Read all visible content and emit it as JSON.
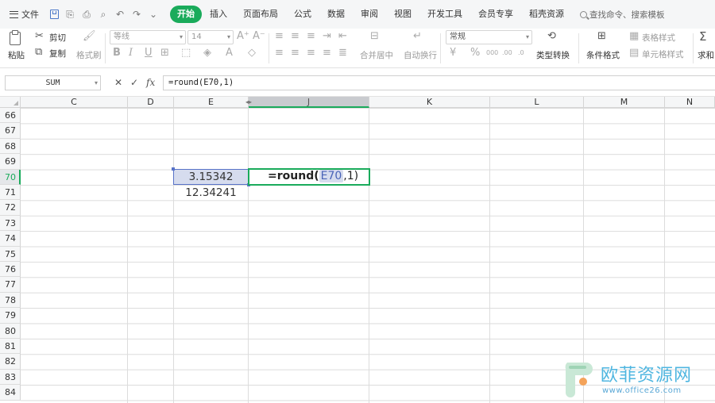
{
  "menubar": {
    "file_label": "文件",
    "tabs": [
      {
        "label": "开始",
        "active": true
      },
      {
        "label": "插入"
      },
      {
        "label": "页面布局"
      },
      {
        "label": "公式"
      },
      {
        "label": "数据"
      },
      {
        "label": "审阅"
      },
      {
        "label": "视图"
      },
      {
        "label": "开发工具"
      },
      {
        "label": "会员专享"
      },
      {
        "label": "稻壳资源"
      }
    ],
    "search_placeholder": "查找命令、搜索模板"
  },
  "ribbon": {
    "paste": "粘贴",
    "cut": "剪切",
    "copy": "复制",
    "format_painter": "格式刷",
    "font_name": "等线",
    "font_size": "14",
    "merge_center": "合并居中",
    "wrap_text": "自动换行",
    "number_format": "常规",
    "type_convert": "类型转换",
    "conditional_format": "条件格式",
    "table_style": "表格样式",
    "cell_style": "单元格样式",
    "sum": "求和"
  },
  "formula_bar": {
    "name_box": "SUM",
    "formula": "=round(E70,1)"
  },
  "sheet": {
    "columns": [
      {
        "label": "C"
      },
      {
        "label": "D"
      },
      {
        "label": "E"
      },
      {
        "label": "J",
        "selected": true
      },
      {
        "label": "K"
      },
      {
        "label": "L"
      },
      {
        "label": "M"
      },
      {
        "label": "N"
      }
    ],
    "rows": [
      "66",
      "67",
      "68",
      "69",
      "70",
      "71",
      "72",
      "73",
      "74",
      "75",
      "76",
      "77",
      "78",
      "79",
      "80",
      "81",
      "82",
      "83",
      "84"
    ],
    "selected_row": "70",
    "cells": {
      "E70": "3.15342",
      "E71": "12.34241"
    },
    "editing": {
      "prefix": "=",
      "func": "round(",
      "ref": "E70",
      "rest": ",1)"
    }
  },
  "watermark": {
    "text": "欧菲资源网",
    "url": "www.office26.com"
  },
  "colors": {
    "accent_green": "#1aab5b",
    "selection_blue": "#5873c8",
    "selection_fill": "#d6dcee"
  }
}
